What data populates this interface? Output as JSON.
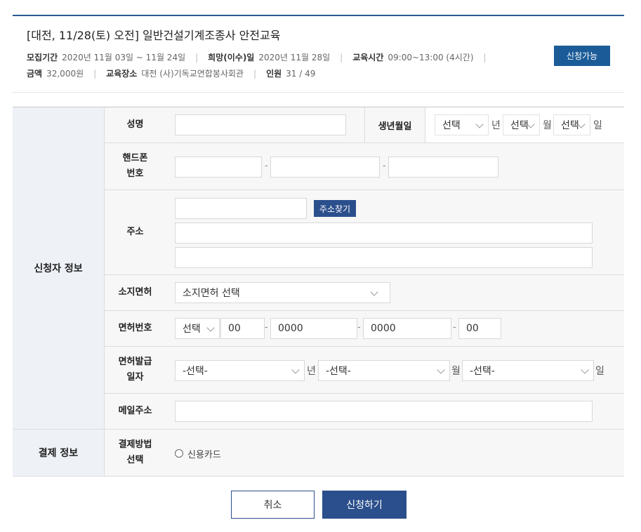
{
  "course": {
    "title": "[대전, 11/28(토) 오전] 일반건설기계조종사 안전교육",
    "recruit_label": "모집기간",
    "recruit_value": "2020년 11월 03일 ~ 11월 24일",
    "wish_label": "희망(이수)일",
    "wish_value": "2020년 11월 28일",
    "time_label": "교육시간",
    "time_value": "09:00~13:00 (4시간)",
    "fee_label": "금액",
    "fee_value": "32,000원",
    "place_label": "교육장소",
    "place_value": "대전 (사)기독교연합봉사회관",
    "people_label": "인원",
    "people_value": "31 / 49",
    "status": "신청가능"
  },
  "applicant": {
    "section_label": "신청자 정보",
    "name_label": "성명",
    "name_value": "",
    "birth_label": "생년월일",
    "birth_year": "선택",
    "birth_year_unit": "년",
    "birth_month": "선택",
    "birth_month_unit": "월",
    "birth_day": "선택",
    "birth_day_unit": "일",
    "phone_label_1": "핸드폰",
    "phone_label_2": "번호",
    "phone_sep": "-",
    "address_label": "주소",
    "address_find": "주소찾기",
    "license_label": "소지면허",
    "license_select": "소지면허 선택",
    "license_no_label": "면허번호",
    "license_no_region": "선택",
    "license_no_1": "00",
    "license_no_2": "0000",
    "license_no_3": "0000",
    "license_no_4": "00",
    "issue_label_1": "면허발급",
    "issue_label_2": "일자",
    "issue_year": "-선택-",
    "issue_year_unit": "년",
    "issue_month": "-선택-",
    "issue_month_unit": "월",
    "issue_day": "-선택-",
    "issue_day_unit": "일",
    "email_label": "메일주소"
  },
  "payment": {
    "section_label": "결제 정보",
    "method_label_1": "결제방법",
    "method_label_2": "선택",
    "option_card": "신용카드"
  },
  "actions": {
    "cancel": "취소",
    "submit": "신청하기"
  },
  "colors": {
    "accent": "#2b4f8c",
    "status": "#1b5c98",
    "section_bg": "#eef2f7"
  }
}
